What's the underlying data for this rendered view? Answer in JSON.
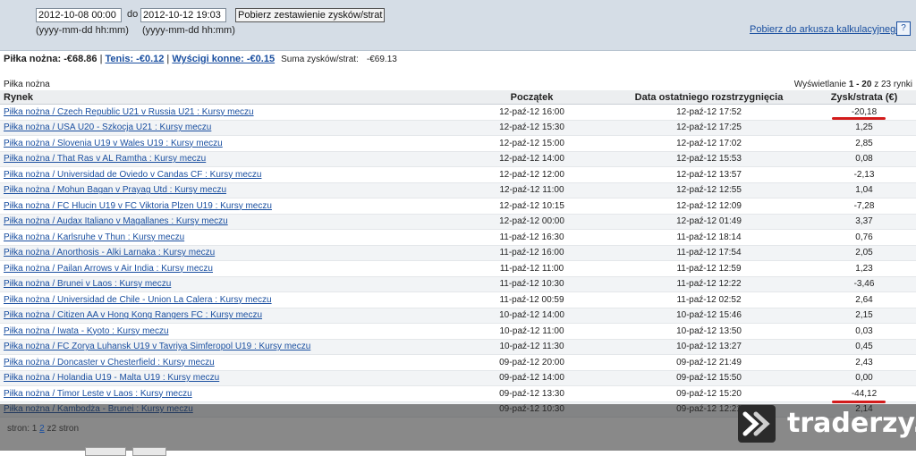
{
  "filter": {
    "date_from": "2012-10-08 00:00",
    "to_label": "do",
    "date_to": "2012-10-12 19:03",
    "submit_label": "Pobierz zestawienie zysków/strat",
    "format_hint_from": "(yyyy-mm-dd hh:mm)",
    "format_hint_to": "(yyyy-mm-dd hh:mm)",
    "spreadsheet_link": "Pobierz do arkusza kalkulacyjnego",
    "help_label": "?"
  },
  "summary": {
    "football_label": "Piłka nożna: -€68.86",
    "sep1": " | ",
    "tennis_link": "Tenis: -€0.12",
    "sep2": " | ",
    "horse_link": "Wyścigi konne: -€0.15",
    "total_label": "Suma zysków/strat:",
    "total_value": "-€69.13"
  },
  "section": {
    "title": "Piłka nożna",
    "paging_prefix": "Wyświetlanie ",
    "paging_range": "1 - 20",
    "paging_suffix": " z 23 rynki"
  },
  "table": {
    "headers": [
      "Rynek",
      "Początek",
      "Data ostatniego rozstrzygnięcia",
      "Zysk/strata (€)"
    ],
    "rows": [
      [
        "Piłka nożna / Czech Republic U21 v Russia U21 : Kursy meczu",
        "12-paź-12 16:00",
        "12-paź-12 17:52",
        "-20,18"
      ],
      [
        "Piłka nożna / USA U20 - Szkocja U21 : Kursy meczu",
        "12-paź-12 15:30",
        "12-paź-12 17:25",
        "1,25"
      ],
      [
        "Piłka nożna / Slovenia U19 v Wales U19 : Kursy meczu",
        "12-paź-12 15:00",
        "12-paź-12 17:02",
        "2,85"
      ],
      [
        "Piłka nożna / That Ras v AL Ramtha : Kursy meczu",
        "12-paź-12 14:00",
        "12-paź-12 15:53",
        "0,08"
      ],
      [
        "Piłka nożna / Universidad de Oviedo v Candas CF : Kursy meczu",
        "12-paź-12 12:00",
        "12-paź-12 13:57",
        "-2,13"
      ],
      [
        "Piłka nożna / Mohun Bagan v Prayag Utd : Kursy meczu",
        "12-paź-12 11:00",
        "12-paź-12 12:55",
        "1,04"
      ],
      [
        "Piłka nożna / FC Hlucin U19 v FC Viktoria Plzen U19 : Kursy meczu",
        "12-paź-12 10:15",
        "12-paź-12 12:09",
        "-7,28"
      ],
      [
        "Piłka nożna / Audax Italiano v Magallanes : Kursy meczu",
        "12-paź-12 00:00",
        "12-paź-12 01:49",
        "3,37"
      ],
      [
        "Piłka nożna / Karlsruhe v Thun : Kursy meczu",
        "11-paź-12 16:30",
        "11-paź-12 18:14",
        "0,76"
      ],
      [
        "Piłka nożna / Anorthosis - Alki Larnaka : Kursy meczu",
        "11-paź-12 16:00",
        "11-paź-12 17:54",
        "2,05"
      ],
      [
        "Piłka nożna / Pailan Arrows v Air India : Kursy meczu",
        "11-paź-12 11:00",
        "11-paź-12 12:59",
        "1,23"
      ],
      [
        "Piłka nożna / Brunei v Laos : Kursy meczu",
        "11-paź-12 10:30",
        "11-paź-12 12:22",
        "-3,46"
      ],
      [
        "Piłka nożna / Universidad de Chile - Union La Calera : Kursy meczu",
        "11-paź-12 00:59",
        "11-paź-12 02:52",
        "2,64"
      ],
      [
        "Piłka nożna / Citizen AA v Hong Kong Rangers FC : Kursy meczu",
        "10-paź-12 14:00",
        "10-paź-12 15:46",
        "2,15"
      ],
      [
        "Piłka nożna / Iwata - Kyoto : Kursy meczu",
        "10-paź-12 11:00",
        "10-paź-12 13:50",
        "0,03"
      ],
      [
        "Piłka nożna / FC Zorya Luhansk U19 v Tavriya Simferopol U19 : Kursy meczu",
        "10-paź-12 11:30",
        "10-paź-12 13:27",
        "0,45"
      ],
      [
        "Piłka nożna / Doncaster v Chesterfield : Kursy meczu",
        "09-paź-12 20:00",
        "09-paź-12 21:49",
        "2,43"
      ],
      [
        "Piłka nożna / Holandia U19 - Malta U19 : Kursy meczu",
        "09-paź-12 14:00",
        "09-paź-12 15:50",
        "0,00"
      ],
      [
        "Piłka nożna / Timor Leste v Laos : Kursy meczu",
        "09-paź-12 13:30",
        "09-paź-12 15:20",
        "-44,12"
      ],
      [
        "Piłka nożna / Kambodża - Brunei : Kursy meczu",
        "09-paź-12 10:30",
        "09-paź-12 12:21",
        "2,14"
      ]
    ]
  },
  "pager": {
    "label": "stron:",
    "page1": "1",
    "page2": "2",
    "suffix": "z2 stron"
  },
  "watermark": {
    "text": "traderzy.pl"
  },
  "colors": {
    "header_bar": "#d5dde6",
    "link": "#1a4fa0",
    "highlight_red": "#d31b1b"
  }
}
